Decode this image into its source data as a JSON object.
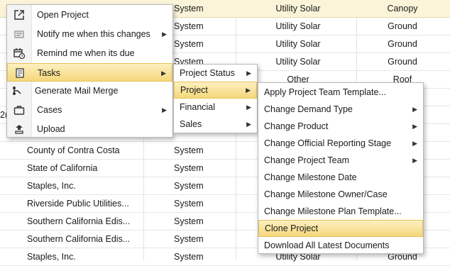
{
  "grid": {
    "rows": [
      {
        "name": "",
        "source": "System",
        "type": "Utility Solar",
        "mount": "Canopy"
      },
      {
        "name": "",
        "source": "System",
        "type": "Utility Solar",
        "mount": "Ground"
      },
      {
        "name": "",
        "source": "System",
        "type": "Utility Solar",
        "mount": "Ground"
      },
      {
        "name": "",
        "source": "System",
        "type": "Utility Solar",
        "mount": "Ground"
      },
      {
        "name": "",
        "source": "",
        "type": "Other",
        "mount": "Roof"
      },
      {
        "name": "",
        "source": "",
        "type": "",
        "mount": ""
      },
      {
        "name": "",
        "source": "",
        "type": "",
        "mount": ""
      },
      {
        "name": "",
        "source": "",
        "type": "",
        "mount": ""
      },
      {
        "name": "County of Contra Costa",
        "source": "System",
        "type": "",
        "mount": ""
      },
      {
        "name": "State of California",
        "source": "System",
        "type": "",
        "mount": ""
      },
      {
        "name": "Staples, Inc.",
        "source": "System",
        "type": "",
        "mount": ""
      },
      {
        "name": "Riverside Public Utilities...",
        "source": "System",
        "type": "",
        "mount": ""
      },
      {
        "name": "Southern California Edis...",
        "source": "System",
        "type": "",
        "mount": ""
      },
      {
        "name": "Southern California Edis...",
        "source": "System",
        "type": "",
        "mount": ""
      },
      {
        "name": "Staples, Inc.",
        "source": "System",
        "type": "Utility Solar",
        "mount": "Ground"
      }
    ],
    "partial_text": "2("
  },
  "context_menu": {
    "items": [
      {
        "label": "Open Project",
        "icon": "open-external-icon",
        "submenu": false
      },
      {
        "label": "Notify me when this changes",
        "icon": "notify-icon",
        "submenu": true
      },
      {
        "label": "Remind me when its due",
        "icon": "calendar-clock-icon",
        "submenu": false
      },
      {
        "label": "Tasks",
        "icon": "tasks-icon",
        "submenu": true,
        "highlighted": true
      },
      {
        "label": "Generate Mail Merge",
        "icon": "mail-merge-icon",
        "submenu": false
      },
      {
        "label": "Cases",
        "icon": "briefcase-icon",
        "submenu": true
      },
      {
        "label": "Upload",
        "icon": "upload-icon",
        "submenu": false
      }
    ]
  },
  "tasks_menu": {
    "items": [
      {
        "label": "Project Status",
        "submenu": true
      },
      {
        "label": "Project",
        "submenu": true,
        "highlighted": true
      },
      {
        "label": "Financial",
        "submenu": true
      },
      {
        "label": "Sales",
        "submenu": true
      }
    ]
  },
  "project_menu": {
    "items": [
      {
        "label": "Apply Project Team Template...",
        "submenu": false
      },
      {
        "label": "Change Demand Type",
        "submenu": true
      },
      {
        "label": "Change Product",
        "submenu": true
      },
      {
        "label": "Change Official Reporting Stage",
        "submenu": true
      },
      {
        "label": "Change Project Team",
        "submenu": true
      },
      {
        "label": "Change Milestone Date",
        "submenu": false
      },
      {
        "label": "Change Milestone Owner/Case",
        "submenu": false
      },
      {
        "label": "Change Milestone Plan Template...",
        "submenu": false
      },
      {
        "label": "Clone Project",
        "submenu": false,
        "highlighted": true
      },
      {
        "label": "Download All Latest Documents",
        "submenu": false
      }
    ]
  },
  "colors": {
    "header_bg": "#fbf4d8",
    "highlight_top": "#fdf0c0",
    "highlight_bottom": "#f5d77a",
    "menu_border": "#b9b9b9"
  }
}
